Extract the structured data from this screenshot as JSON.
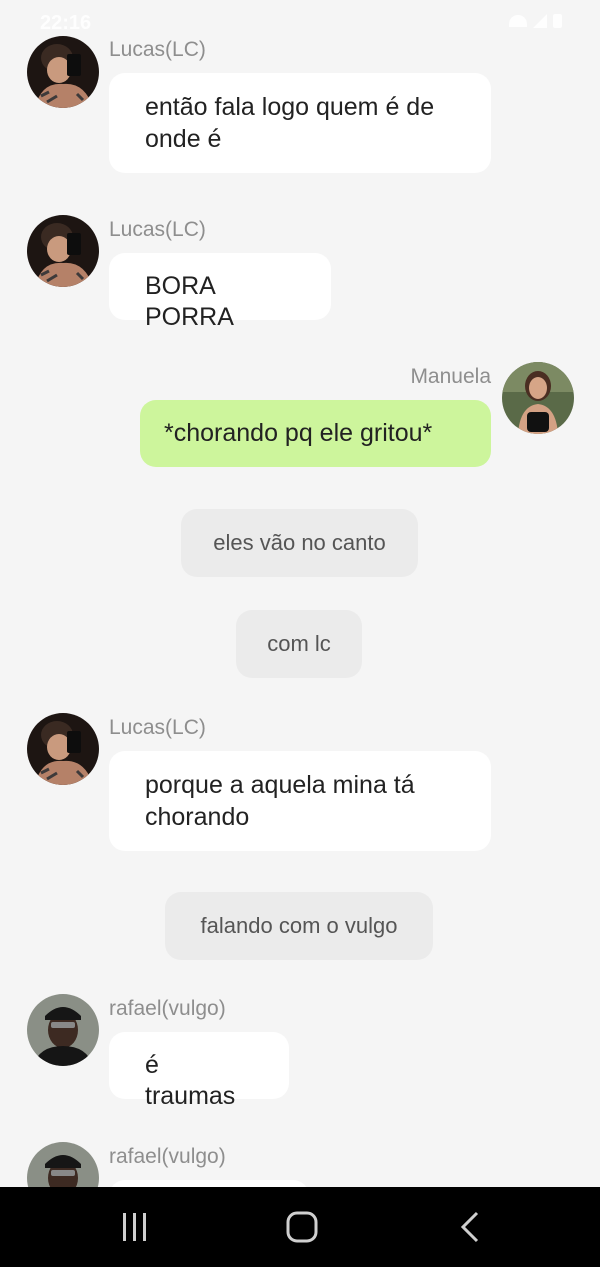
{
  "status_bar": {
    "time": "22:16"
  },
  "colors": {
    "background": "#f5f5f5",
    "incoming_bubble": "#ffffff",
    "outgoing_bubble": "#cdf59c",
    "system_bubble": "#ebebeb",
    "sender_text": "#8e8e8e",
    "nav_bar": "#000000"
  },
  "messages": [
    {
      "sender": "Lucas(LC)",
      "text": "então fala logo quem é de onde é"
    },
    {
      "sender": "Lucas(LC)",
      "text": "BORA PORRA"
    },
    {
      "sender": "Manuela",
      "text": "*chorando pq ele gritou*"
    },
    {
      "system": "eles vão no canto"
    },
    {
      "system": "com lc"
    },
    {
      "sender": "Lucas(LC)",
      "text": "porque a aquela mina tá chorando"
    },
    {
      "system": "falando com o vulgo"
    },
    {
      "sender": "rafael(vulgo)",
      "text": "é traumas"
    },
    {
      "sender": "rafael(vulgo)",
      "text": ""
    }
  ],
  "nav": {
    "icons": [
      "recent-apps-icon",
      "home-icon",
      "back-icon"
    ]
  }
}
